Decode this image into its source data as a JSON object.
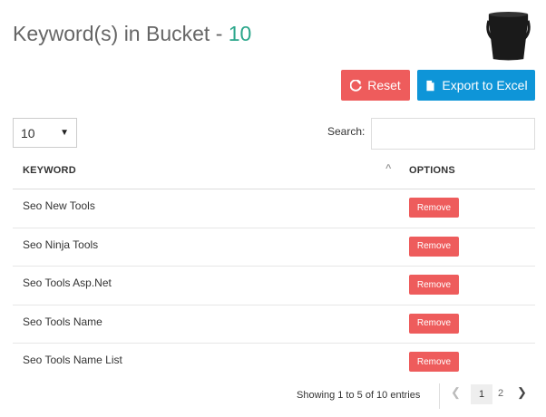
{
  "header": {
    "title": "Keyword(s) in Bucket - ",
    "count": "10",
    "bucket_icon": "bucket-icon"
  },
  "toolbar": {
    "reset_label": "Reset",
    "export_label": "Export to Excel",
    "reset_color": "#ee5c5c",
    "export_color": "#0e95d8"
  },
  "controls": {
    "page_size": "10",
    "search_label": "Search:",
    "search_value": ""
  },
  "table": {
    "headers": {
      "keyword": "KEYWORD",
      "options": "OPTIONS"
    },
    "sort_indicator": "^",
    "rows": [
      {
        "keyword": "Seo New Tools",
        "action": "Remove"
      },
      {
        "keyword": "Seo Ninja Tools",
        "action": "Remove"
      },
      {
        "keyword": "Seo Tools Asp.Net",
        "action": "Remove"
      },
      {
        "keyword": "Seo Tools Name",
        "action": "Remove"
      },
      {
        "keyword": "Seo Tools Name List",
        "action": "Remove"
      }
    ]
  },
  "pagination": {
    "info": "Showing 1 to 5 of 10 entries",
    "pages": [
      "1",
      "2"
    ],
    "current": "1"
  }
}
